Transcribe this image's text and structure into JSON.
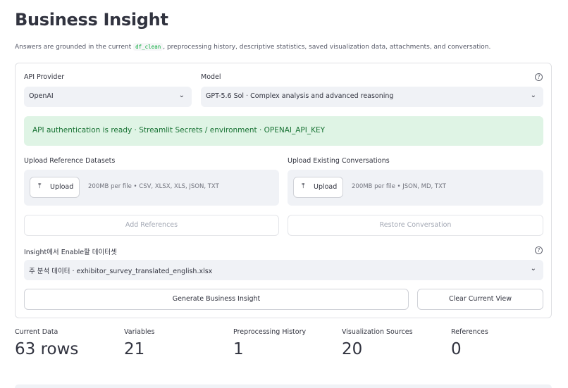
{
  "page": {
    "title": "Business Insight",
    "subtitle_before": "Answers are grounded in the current",
    "subtitle_code": "df_clean",
    "subtitle_after": ", preprocessing history, descriptive statistics, saved visualization data, attachments, and conversation."
  },
  "config": {
    "api_provider_label": "API Provider",
    "api_provider_value": "OpenAI",
    "model_label": "Model",
    "model_value": "GPT-5.6 Sol · Complex analysis and advanced reasoning",
    "help_glyph": "?",
    "alert_text": "API authentication is ready · Streamlit Secrets / environment · OPENAI_API_KEY"
  },
  "uploads": {
    "reference_label": "Upload Reference Datasets",
    "reference_hint": "200MB per file • CSV, XLSX, XLS, JSON, TXT",
    "conversation_label": "Upload Existing Conversations",
    "conversation_hint": "200MB per file • JSON, MD, TXT",
    "upload_button": "Upload",
    "upload_icon": "upload-icon",
    "add_references": "Add References",
    "restore_conversation": "Restore Conversation"
  },
  "dataset": {
    "label": "Insight에서 Enable할 데이터셋",
    "value": "주 분석 데이터 · exhibitor_survey_translated_english.xlsx"
  },
  "actions": {
    "generate": "Generate Business Insight",
    "clear": "Clear Current View"
  },
  "metrics": [
    {
      "label": "Current Data",
      "value": "63 rows"
    },
    {
      "label": "Variables",
      "value": "21"
    },
    {
      "label": "Preprocessing History",
      "value": "1"
    },
    {
      "label": "Visualization Sources",
      "value": "20"
    },
    {
      "label": "References",
      "value": "0"
    }
  ],
  "colors": {
    "alert_bg": "#dff4e5",
    "alert_text": "#177233",
    "input_bg": "#f0f2f6",
    "text": "#31333f"
  }
}
